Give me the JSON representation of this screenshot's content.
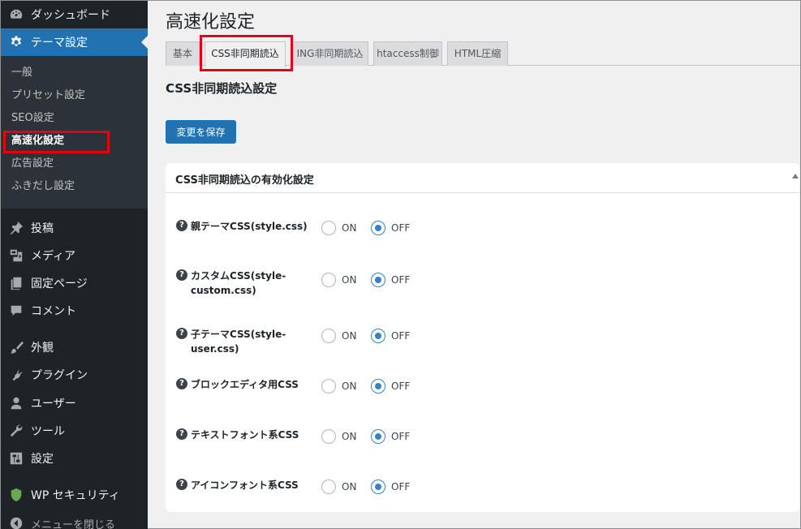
{
  "sidebar": {
    "dashboard_label": "ダッシュボード",
    "theme_settings_label": "テーマ設定",
    "submenu": [
      "一般",
      "プリセット設定",
      "SEO設定",
      "高速化設定",
      "広告設定",
      "ふきだし設定"
    ],
    "posts_label": "投稿",
    "media_label": "メディア",
    "pages_label": "固定ページ",
    "comments_label": "コメント",
    "appearance_label": "外観",
    "plugins_label": "プラグイン",
    "users_label": "ユーザー",
    "tools_label": "ツール",
    "settings_label": "設定",
    "security_label": "WP セキュリティ",
    "collapse_label": "メニューを閉じる"
  },
  "main": {
    "title": "高速化設定",
    "tabs": [
      "基本",
      "CSS非同期読込",
      "ING非同期読込",
      "htaccess制御",
      "HTML圧縮"
    ],
    "section_title": "CSS非同期読込設定",
    "save_label": "変更を保存"
  },
  "panel": {
    "title": "CSS非同期読込の有効化設定",
    "on_label": "ON",
    "off_label": "OFF",
    "help_glyph": "?",
    "rows": [
      {
        "label": "親テーマCSS(style.css)",
        "value": "OFF"
      },
      {
        "label": "カスタムCSS(style-custom.css)",
        "value": "OFF"
      },
      {
        "label": "子テーマCSS(style-user.css)",
        "value": "OFF"
      },
      {
        "label": "ブロックエディタ用CSS",
        "value": "OFF"
      },
      {
        "label": "テキストフォント系CSS",
        "value": "OFF"
      },
      {
        "label": "アイコンフォント系CSS",
        "value": "OFF"
      }
    ]
  },
  "colors": {
    "sidebar_bg": "#1d2327",
    "submenu_bg": "#2c3338",
    "accent": "#2271b1",
    "highlight_red": "#e60012",
    "radio_checked": "#3582c4"
  }
}
